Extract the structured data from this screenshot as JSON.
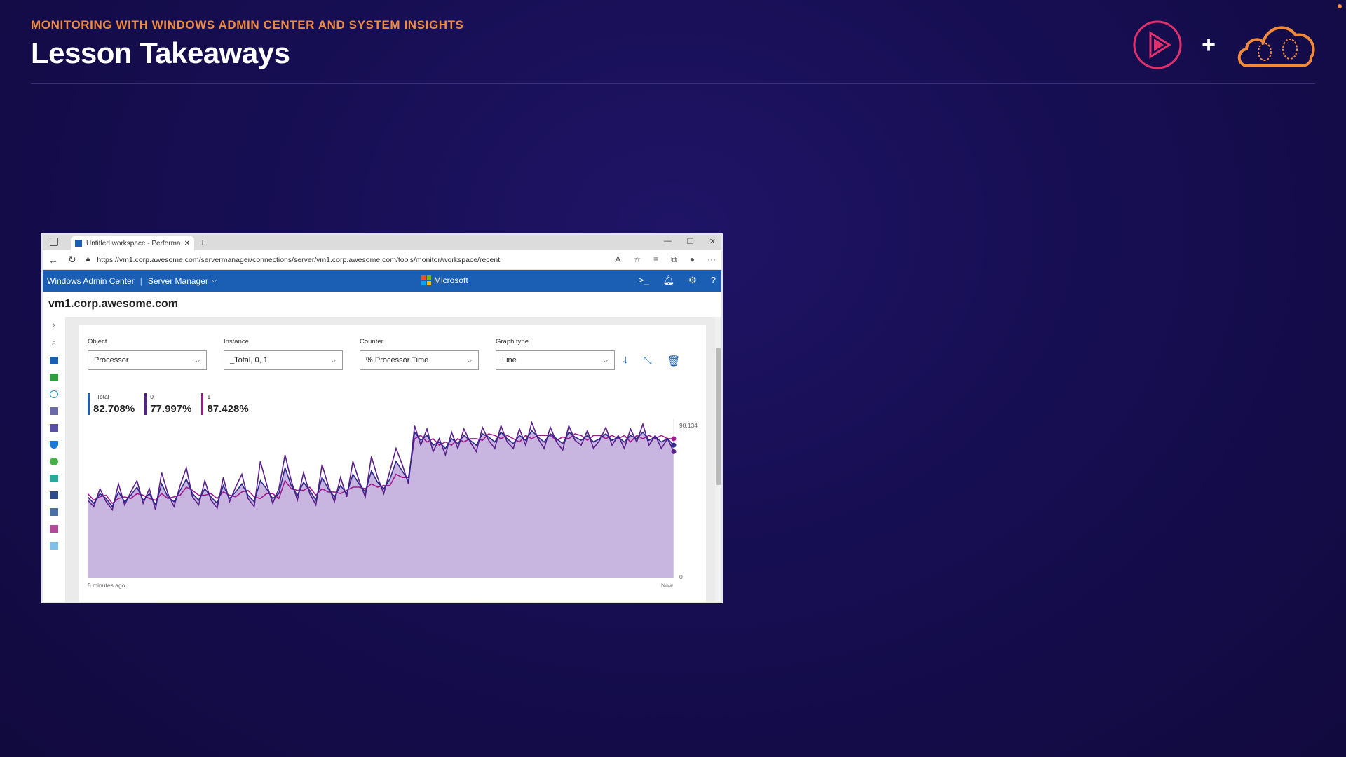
{
  "slide": {
    "eyebrow": "MONITORING WITH WINDOWS ADMIN CENTER AND SYSTEM INSIGHTS",
    "title": "Lesson Takeaways",
    "plus": "+"
  },
  "browser": {
    "tab_title": "Untitled workspace - Performanc",
    "url": "https://vm1.corp.awesome.com/servermanager/connections/server/vm1.corp.awesome.com/tools/monitor/workspace/recent"
  },
  "wac": {
    "app_name": "Windows Admin Center",
    "tool_menu": "Server Manager",
    "brand": "Microsoft",
    "server_name": "vm1.corp.awesome.com"
  },
  "monitor": {
    "object": {
      "label": "Object",
      "value": "Processor"
    },
    "instance": {
      "label": "Instance",
      "value": "_Total, 0, 1"
    },
    "counter": {
      "label": "Counter",
      "value": "% Processor Time"
    },
    "graph_type": {
      "label": "Graph type",
      "value": "Line"
    },
    "legend": [
      {
        "name": "_Total",
        "value": "82.708%",
        "color": "#1a5fb4"
      },
      {
        "name": "0",
        "value": "77.997%",
        "color": "#5b1f8a"
      },
      {
        "name": "1",
        "value": "87.428%",
        "color": "#a3178f"
      }
    ],
    "y_max_label": "98.134",
    "y_min_label": "0",
    "x_start_label": "5 minutes ago",
    "x_end_label": "Now"
  },
  "chart_data": {
    "type": "line",
    "ylim": [
      0,
      98.134
    ],
    "x_start": "5 minutes ago",
    "x_end": "Now",
    "series": [
      {
        "name": "_Total",
        "color": "#2d2a8c",
        "values": [
          50,
          46,
          52,
          49,
          44,
          53,
          47,
          51,
          56,
          48,
          52,
          45,
          58,
          50,
          47,
          54,
          61,
          52,
          48,
          55,
          50,
          46,
          57,
          49,
          53,
          58,
          51,
          47,
          60,
          55,
          49,
          52,
          68,
          57,
          51,
          59,
          54,
          48,
          62,
          55,
          50,
          57,
          52,
          64,
          58,
          53,
          66,
          59,
          55,
          61,
          72,
          66,
          60,
          90,
          85,
          88,
          82,
          84,
          80,
          86,
          83,
          88,
          85,
          82,
          89,
          87,
          84,
          90,
          86,
          83,
          88,
          85,
          91,
          87,
          84,
          89,
          86,
          83,
          90,
          87,
          85,
          88,
          84,
          86,
          89,
          85,
          87,
          84,
          88,
          86,
          90,
          85,
          87,
          84,
          86,
          82
        ]
      },
      {
        "name": "0",
        "color": "#5b1f8a",
        "values": [
          48,
          44,
          55,
          47,
          42,
          58,
          45,
          53,
          60,
          46,
          55,
          42,
          65,
          52,
          44,
          57,
          68,
          50,
          45,
          60,
          48,
          43,
          62,
          47,
          56,
          64,
          49,
          44,
          72,
          58,
          46,
          55,
          76,
          60,
          48,
          65,
          52,
          45,
          70,
          57,
          47,
          62,
          50,
          72,
          60,
          50,
          75,
          62,
          52,
          66,
          80,
          70,
          58,
          94,
          82,
          92,
          78,
          86,
          76,
          90,
          80,
          92,
          84,
          78,
          93,
          85,
          80,
          94,
          84,
          80,
          92,
          82,
          96,
          86,
          80,
          93,
          84,
          79,
          94,
          85,
          82,
          91,
          80,
          85,
          93,
          82,
          88,
          80,
          92,
          84,
          95,
          82,
          88,
          80,
          86,
          78
        ]
      },
      {
        "name": "1",
        "color": "#a3178f",
        "values": [
          52,
          48,
          50,
          51,
          46,
          49,
          50,
          49,
          52,
          51,
          49,
          48,
          52,
          49,
          50,
          51,
          56,
          54,
          51,
          51,
          52,
          49,
          53,
          51,
          50,
          53,
          54,
          50,
          49,
          52,
          52,
          49,
          60,
          55,
          54,
          54,
          56,
          51,
          55,
          53,
          53,
          52,
          54,
          56,
          56,
          55,
          58,
          56,
          57,
          57,
          64,
          62,
          62,
          86,
          88,
          84,
          86,
          82,
          84,
          82,
          86,
          84,
          86,
          86,
          85,
          89,
          88,
          86,
          88,
          86,
          84,
          88,
          86,
          88,
          88,
          88,
          85,
          87,
          86,
          89,
          88,
          85,
          88,
          88,
          86,
          88,
          86,
          88,
          84,
          88,
          86,
          88,
          86,
          88,
          86,
          86
        ]
      }
    ]
  }
}
